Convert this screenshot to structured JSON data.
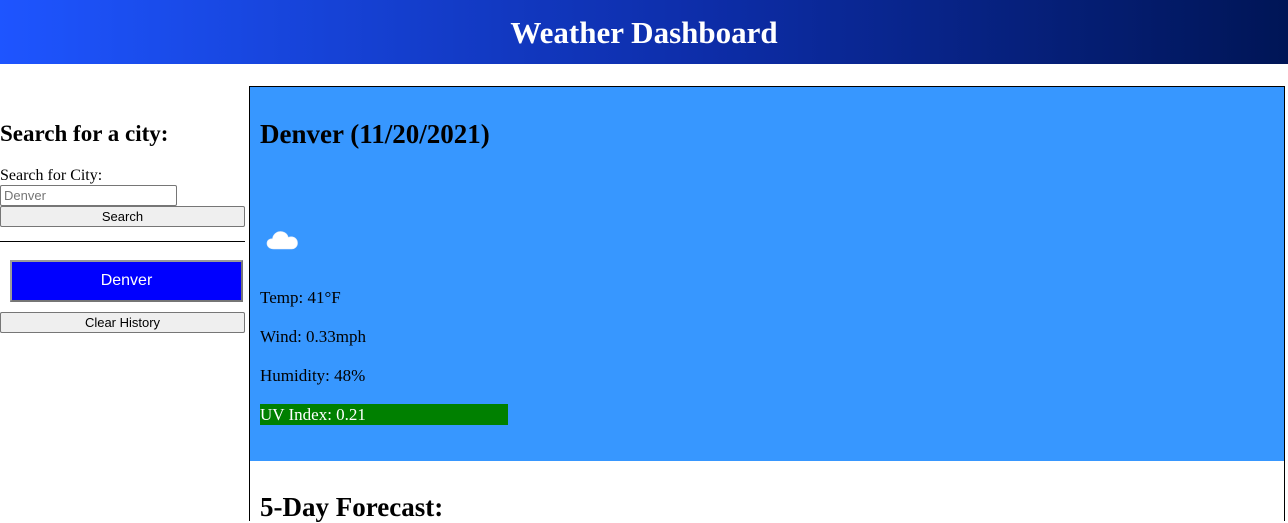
{
  "header": {
    "title": "Weather Dashboard"
  },
  "sidebar": {
    "heading": "Search for a city:",
    "search_label": "Search for City:",
    "search_placeholder": "Denver",
    "search_button": "Search",
    "history": [
      "Denver"
    ],
    "clear_button": "Clear History"
  },
  "current": {
    "title": "Denver (11/20/2021)",
    "icon": "cloud-icon",
    "temp": "Temp: 41°F",
    "wind": "Wind: 0.33mph",
    "humidity": "Humidity: 48%",
    "uv": "UV Index: 0.21"
  },
  "forecast": {
    "title": "5-Day Forecast:"
  },
  "colors": {
    "header_start": "#1e55ff",
    "header_end": "#001556",
    "current_bg": "#3797ff",
    "history_button": "#0000ff",
    "uv_low": "#008000"
  }
}
